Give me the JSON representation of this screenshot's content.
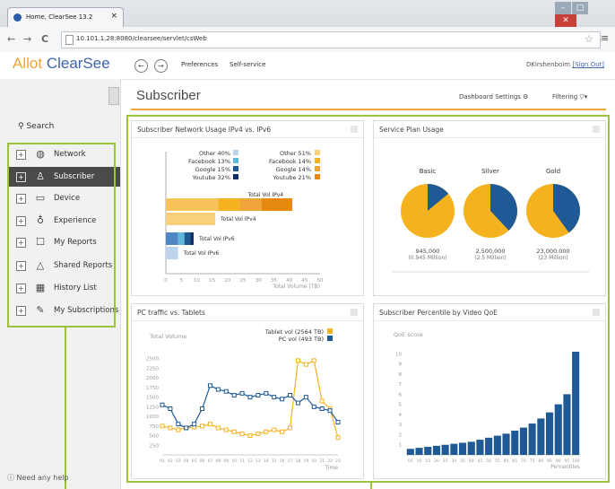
{
  "browser": {
    "tab_title": "Home, ClearSee 13.2",
    "tab_close": "×",
    "url": "10.101.1.28:8080/clearsee/servlet/csWeb",
    "back": "←",
    "forward": "→",
    "reload": "C",
    "star": "☆",
    "menu": "≡",
    "win_min": "–",
    "win_max": "□",
    "win_close": "✕"
  },
  "app": {
    "logo_allot": "Allot",
    "logo_clearsee": "ClearSee",
    "back_btn": "←",
    "fwd_btn": "→",
    "preferences": "Preferences",
    "self_service": "Self-service",
    "user": "DKirshenboim",
    "sign_out": "[Sign Out]"
  },
  "sidebar": {
    "search_label": "Search",
    "items": [
      {
        "label": "Network",
        "icon": "globe-icon"
      },
      {
        "label": "Subscriber",
        "icon": "user-icon"
      },
      {
        "label": "Device",
        "icon": "monitor-icon"
      },
      {
        "label": "Experience",
        "icon": "location-pin-icon"
      },
      {
        "label": "My Reports",
        "icon": "inbox-icon"
      },
      {
        "label": "Shared Reports",
        "icon": "cloud-icon"
      },
      {
        "label": "History List",
        "icon": "calendar-icon"
      },
      {
        "label": "My Subscriptions",
        "icon": "edit-icon"
      }
    ],
    "help": "Need any help"
  },
  "main": {
    "title": "Subscriber",
    "dashboard_settings": "Dashboard Settings",
    "filtering": "Filtering"
  },
  "panels": {
    "network_usage": "Subscriber Network Usage IPv4 vs. IPv6",
    "service_plan": "Service Plan Usage",
    "pc_traffic": "PC traffic vs. Tablets",
    "percentile": "Subscriber Percentile by Video QoE"
  },
  "colors": {
    "brand_orange": "#f0a43a",
    "brand_blue": "#3e66a8",
    "highlight_green": "#9bc43a",
    "chart_blue": "#1f5a96",
    "chart_yellow": "#f5b21f"
  },
  "chart_data": [
    {
      "type": "bar",
      "orientation": "horizontal",
      "stacked": true,
      "title": "Subscriber Network Usage IPv4 vs. IPv6",
      "xlabel": "Total Volume (TB)",
      "xlim": [
        0,
        50
      ],
      "xticks": [
        0,
        5,
        10,
        15,
        20,
        25,
        30,
        35,
        40,
        45,
        50
      ],
      "legend_left": [
        "Other 40%",
        "Facebook 13%",
        "Google 15%",
        "Youtube 32%"
      ],
      "legend_right": [
        "Other 51%",
        "Facebook 14%",
        "Google 14%",
        "Youtube 21%"
      ],
      "categories": [
        "Total Vol IPv4",
        "Total Vol IPv4",
        "Total Vol IPv6",
        "Total Vol IPv6"
      ],
      "series": [
        {
          "values": [
            0,
            16,
            0,
            4
          ]
        },
        {
          "values": [
            0,
            0,
            0,
            0
          ]
        },
        {
          "values": [
            0,
            0,
            0,
            0
          ]
        },
        {
          "values": [
            0,
            0,
            0,
            0
          ]
        }
      ],
      "stacks": [
        [
          [
            17,
            "#f7c35a"
          ],
          [
            7,
            "#f5b21f"
          ],
          [
            7,
            "#f0a43a"
          ],
          [
            10,
            "#e8890f"
          ]
        ],
        [
          [
            16,
            "#f8d07a"
          ]
        ],
        [
          [
            4,
            "#4f86c6"
          ],
          [
            2,
            "#5fb8d8"
          ],
          [
            2,
            "#1f5a96"
          ],
          [
            1,
            "#0f2f66"
          ]
        ],
        [
          [
            4,
            "#bcd3ec"
          ]
        ]
      ]
    },
    {
      "type": "pie",
      "title": "Service Plan Usage",
      "categories": [
        "Basic",
        "Silver",
        "Gold"
      ],
      "values_labels": [
        [
          "945,000",
          "(0.945 Million)"
        ],
        [
          "2,500,000",
          "(2.5 Million)"
        ],
        [
          "23,000,000",
          "(23 Million)"
        ]
      ],
      "slices": [
        [
          0.14,
          0.86
        ],
        [
          0.38,
          0.62
        ],
        [
          0.4,
          0.6
        ]
      ]
    },
    {
      "type": "line",
      "title": "PC traffic vs. Tablets",
      "ylabel": "Total Volume",
      "xlabel": "Time",
      "ylim": [
        0,
        2750
      ],
      "yticks": [
        250,
        500,
        750,
        1000,
        1250,
        1500,
        1750,
        2000,
        2250,
        2500
      ],
      "x": [
        "01",
        "02",
        "03",
        "04",
        "05",
        "06",
        "07",
        "08",
        "09",
        "10",
        "11",
        "12",
        "13",
        "14",
        "15",
        "16",
        "17",
        "18",
        "19",
        "20",
        "21",
        "22",
        "23"
      ],
      "series": [
        {
          "name": "Tablet vol (2564 TB)",
          "color": "#f5b21f",
          "values": [
            750,
            700,
            650,
            700,
            720,
            750,
            800,
            700,
            650,
            600,
            550,
            500,
            550,
            600,
            650,
            600,
            700,
            2450,
            2350,
            2450,
            1400,
            1200,
            450
          ]
        },
        {
          "name": "PC vol (493 TB)",
          "color": "#1f5a96",
          "values": [
            1300,
            1200,
            800,
            700,
            800,
            1200,
            1800,
            1700,
            1650,
            1550,
            1600,
            1500,
            1550,
            1600,
            1500,
            1450,
            1550,
            1350,
            1500,
            1250,
            1200,
            1150,
            850
          ]
        }
      ]
    },
    {
      "type": "bar",
      "title": "Subscriber Percentile by Video QoE",
      "ylabel": "QoE score",
      "xlabel": "Percentiles",
      "ylim": [
        0,
        11
      ],
      "yticks": [
        1,
        2,
        3,
        4,
        5,
        6,
        7,
        8,
        9,
        10
      ],
      "categories": [
        "05",
        "10",
        "15",
        "20",
        "25",
        "30",
        "35",
        "40",
        "45",
        "50",
        "55",
        "60",
        "65",
        "70",
        "75",
        "80",
        "85",
        "90",
        "95",
        "100"
      ],
      "values": [
        0.6,
        0.7,
        0.8,
        0.9,
        1.0,
        1.1,
        1.2,
        1.3,
        1.5,
        1.7,
        1.9,
        2.1,
        2.4,
        2.7,
        3.1,
        3.6,
        4.2,
        5.0,
        6.0,
        10.2
      ]
    }
  ]
}
